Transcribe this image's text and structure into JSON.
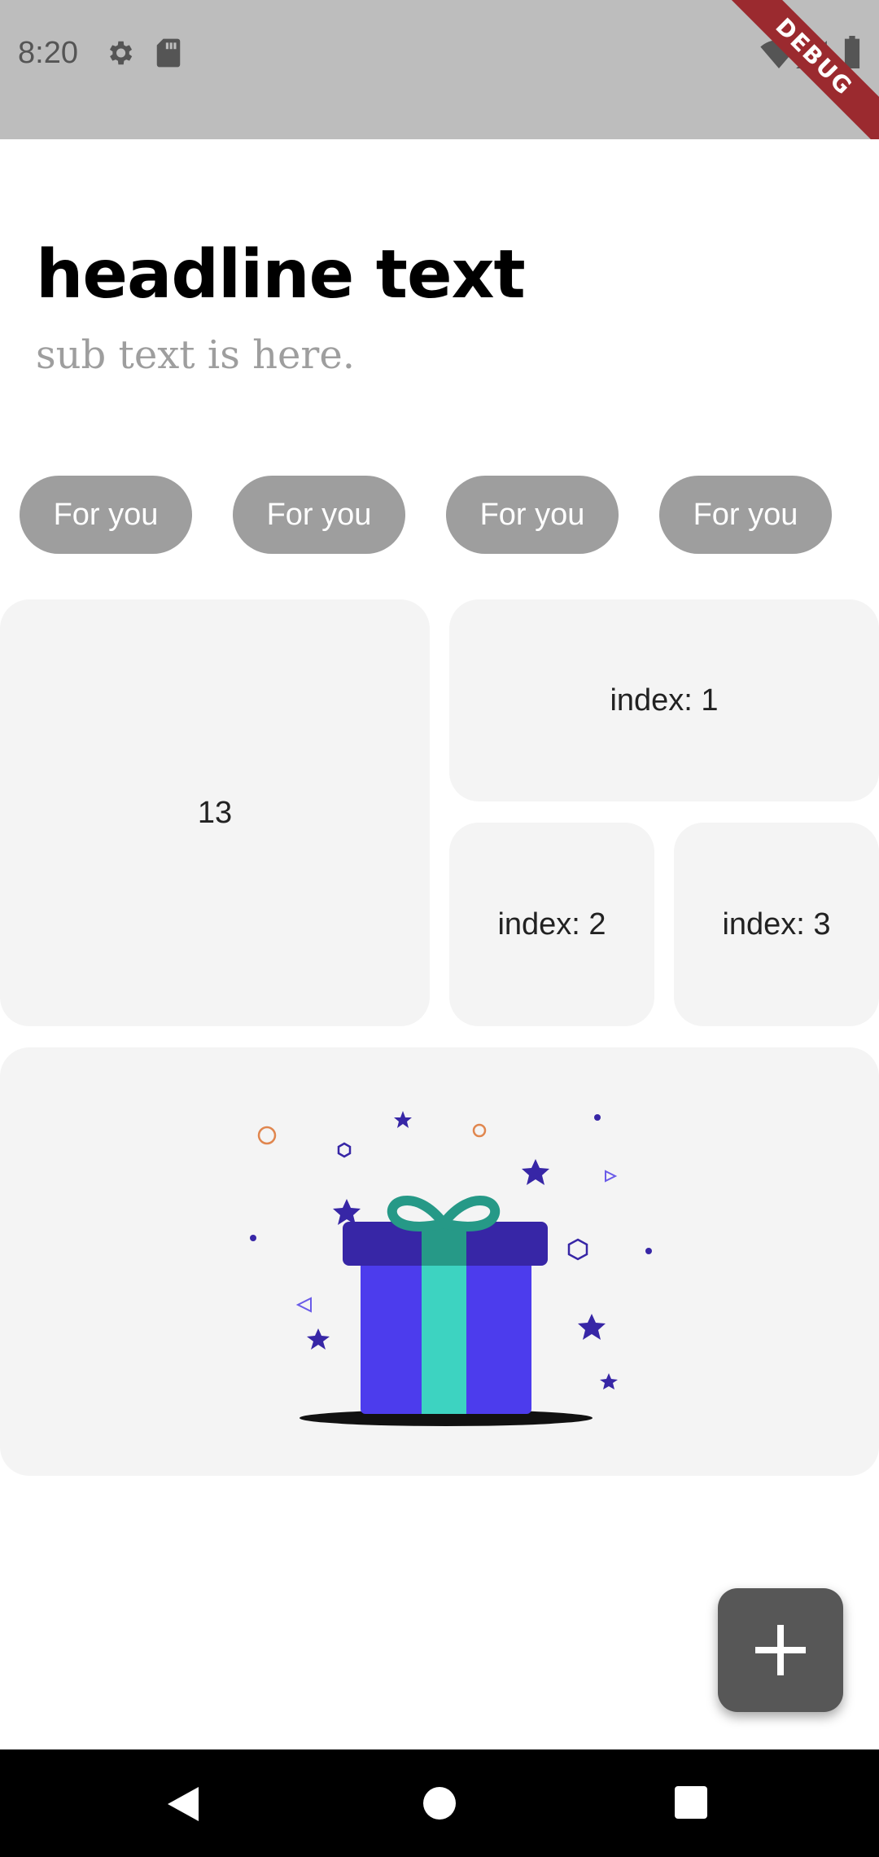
{
  "status_bar": {
    "time": "8:20",
    "icons": [
      "gear-icon",
      "sd-card-icon",
      "wifi-icon",
      "signal-icon",
      "battery-icon"
    ],
    "debug_label": "DEBUG"
  },
  "header": {
    "title": "headline text",
    "subtitle": "sub text is here."
  },
  "chips": [
    {
      "label": "For you"
    },
    {
      "label": "For you"
    },
    {
      "label": "For you"
    },
    {
      "label": "For you"
    }
  ],
  "grid": {
    "tile_large": "13",
    "tile_1": "index: 1",
    "tile_2": "index: 2",
    "tile_3": "index: 3"
  },
  "illustration": "gift-box-icon",
  "fab": {
    "icon": "plus-icon"
  },
  "nav": {
    "icons": [
      "back-icon",
      "home-icon",
      "recents-icon"
    ]
  },
  "colors": {
    "status_bar": "#bdbdbd",
    "chip": "#9e9e9e",
    "tile": "#f4f4f4",
    "fab": "#575757",
    "gift_box": "#4c3ced",
    "gift_lid": "#3726a6",
    "ribbon": "#3dd3c1"
  }
}
